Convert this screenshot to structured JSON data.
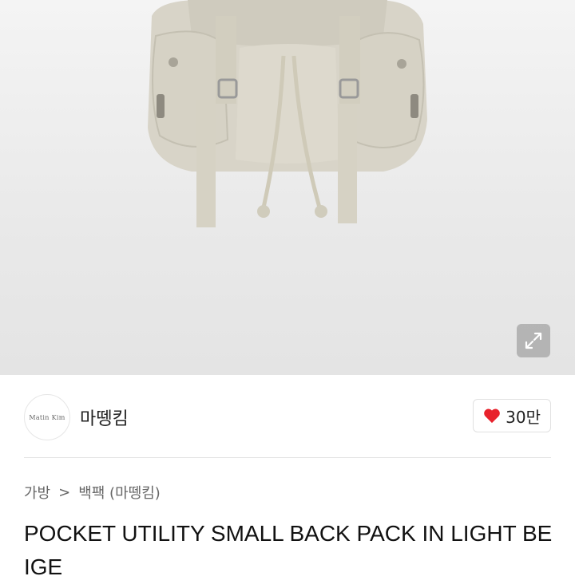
{
  "product_image": {
    "alt": "backpack-photo",
    "expand_icon": "expand-arrows-icon"
  },
  "seller": {
    "avatar_text": "Matin Kim",
    "name": "마뗑킴"
  },
  "like": {
    "icon": "heart-icon",
    "color": "#e8222c",
    "count": "30만"
  },
  "breadcrumb": {
    "items": [
      "가방",
      "백팩 (마뗑킴)"
    ],
    "separator": ">"
  },
  "product": {
    "title": "POCKET UTILITY SMALL BACK PACK IN LIGHT BEIGE"
  }
}
